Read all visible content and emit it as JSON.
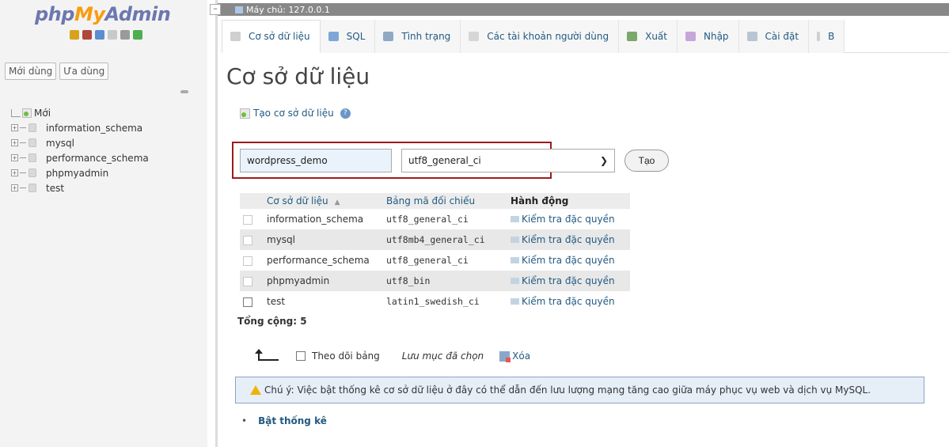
{
  "logo": {
    "php": "php",
    "my": "My",
    "admin": "Admin"
  },
  "sidebar": {
    "tabs": [
      "Mới dùng",
      "Ưa dùng"
    ],
    "tree": [
      {
        "label": "Mới"
      },
      {
        "label": "information_schema"
      },
      {
        "label": "mysql"
      },
      {
        "label": "performance_schema"
      },
      {
        "label": "phpmyadmin"
      },
      {
        "label": "test"
      }
    ]
  },
  "server_bar": {
    "label": "Máy chủ: 127.0.0.1"
  },
  "tabs": [
    {
      "label": "Cơ sở dữ liệu",
      "icon": "database-icon"
    },
    {
      "label": "SQL",
      "icon": "sql-icon"
    },
    {
      "label": "Tình trạng",
      "icon": "status-icon"
    },
    {
      "label": "Các tài khoản người dùng",
      "icon": "users-icon"
    },
    {
      "label": "Xuất",
      "icon": "export-icon"
    },
    {
      "label": "Nhập",
      "icon": "import-icon"
    },
    {
      "label": "Cài đặt",
      "icon": "settings-icon"
    },
    {
      "label": "B",
      "icon": "more-icon"
    }
  ],
  "main": {
    "title": "Cơ sở dữ liệu",
    "create_link": "Tạo cơ sở dữ liệu",
    "db_name_value": "wordpress_demo",
    "collation_value": "utf8_general_ci",
    "create_button": "Tạo",
    "table": {
      "headers": [
        "Cơ sở dữ liệu",
        "Bảng mã đối chiếu",
        "Hành động"
      ],
      "rows": [
        {
          "name": "information_schema",
          "collation": "utf8_general_ci",
          "action": "Kiểm tra đặc quyền"
        },
        {
          "name": "mysql",
          "collation": "utf8mb4_general_ci",
          "action": "Kiểm tra đặc quyền"
        },
        {
          "name": "performance_schema",
          "collation": "utf8_general_ci",
          "action": "Kiểm tra đặc quyền"
        },
        {
          "name": "phpmyadmin",
          "collation": "utf8_bin",
          "action": "Kiểm tra đặc quyền"
        },
        {
          "name": "test",
          "collation": "latin1_swedish_ci",
          "action": "Kiểm tra đặc quyền"
        }
      ]
    },
    "total": "Tổng cộng: 5",
    "bulk": {
      "track_label": "Theo dõi bảng",
      "with_selected": "Lưu mục đã chọn",
      "delete": "Xóa"
    },
    "notice": "Chú ý: Việc bật thống kê cơ sở dữ liệu ở đây có thể dẫn đến lưu lượng mạng tăng cao giữa máy phục vụ web và dịch vụ MySQL.",
    "enable_stats": "Bật thống kê"
  },
  "colors": {
    "link": "#235a81",
    "highlight_border": "#9b1b1b",
    "notice_bg": "#e6eef8"
  }
}
